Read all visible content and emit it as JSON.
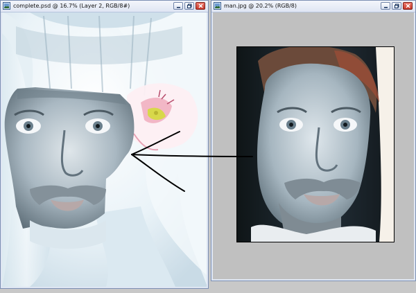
{
  "windows": {
    "left": {
      "title": "complete.psd @ 16.7% (Layer 2, RGB/8#)",
      "controls": [
        "minimize",
        "restore",
        "close"
      ]
    },
    "right": {
      "title": "man.jpg @ 20.2% (RGB/8)",
      "controls": [
        "minimize",
        "restore",
        "close"
      ]
    }
  },
  "icons": {
    "app": "image-document-icon",
    "minimize": "minimize-icon",
    "restore": "restore-icon",
    "close": "close-icon"
  },
  "colors": {
    "titlebar": "#dfe6f3",
    "window_border": "#7b8fb3",
    "close_button": "#c6382b",
    "canvas_gray": "#c0c0c0",
    "arrow": "#000000"
  }
}
